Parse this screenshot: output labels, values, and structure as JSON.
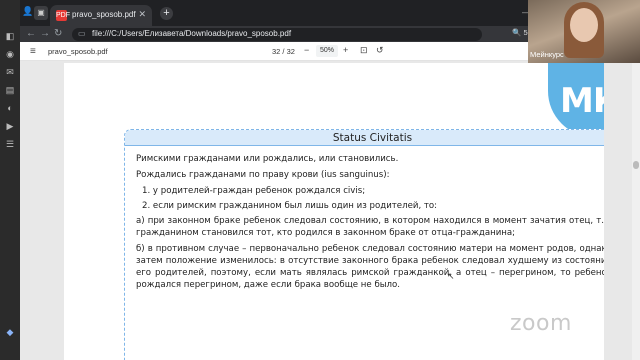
{
  "browser": {
    "tab_title": "pravo_sposob.pdf",
    "tab_favicon": "PDF",
    "url": "file:///C:/Users/Елизавета/Downloads/pravo_sposob.pdf",
    "zoom_indicator": "50%"
  },
  "pdf_toolbar": {
    "file_name": "pravo_sposob.pdf",
    "page_indicator": "32 / 32",
    "zoom_minus": "−",
    "zoom_value": "50%",
    "zoom_plus": "+"
  },
  "slide": {
    "logo": "МК",
    "title": "Status Civitatis",
    "paragraphs": {
      "p1": "Римскими гражданами или рождались, или становились.",
      "p2": "Рождались гражданами по праву крови (ius sanguinus):",
      "li1": "1.  у родителей-граждан ребенок рождался civis;",
      "li2": "2.  если римским гражданином был лишь один из родителей, то:",
      "p3": "а) при законном браке ребенок следовал состоянию, в котором находился в момент зачатия отец, т.е. гражданином становился тот, кто родился в законном браке от отца-гражданина;",
      "p4": "б) в противном случае – первоначально ребенок следовал состоянию матери на момент родов, однако затем положение изменилось: в отсутствие законного брака ребенок следовал худшему из состояний его родителей, поэтому, если мать являлась римской гражданкой, а отец – перегрином, то ребенок рождался перегрином, даже если брака вообще не было."
    }
  },
  "overlay": {
    "participant_name": "Мейнкурс",
    "watermark": "zoom"
  },
  "colors": {
    "accent_blue": "#5fb3e5",
    "card_border": "#7fb6e8",
    "card_header_bg": "#d9eafa"
  }
}
